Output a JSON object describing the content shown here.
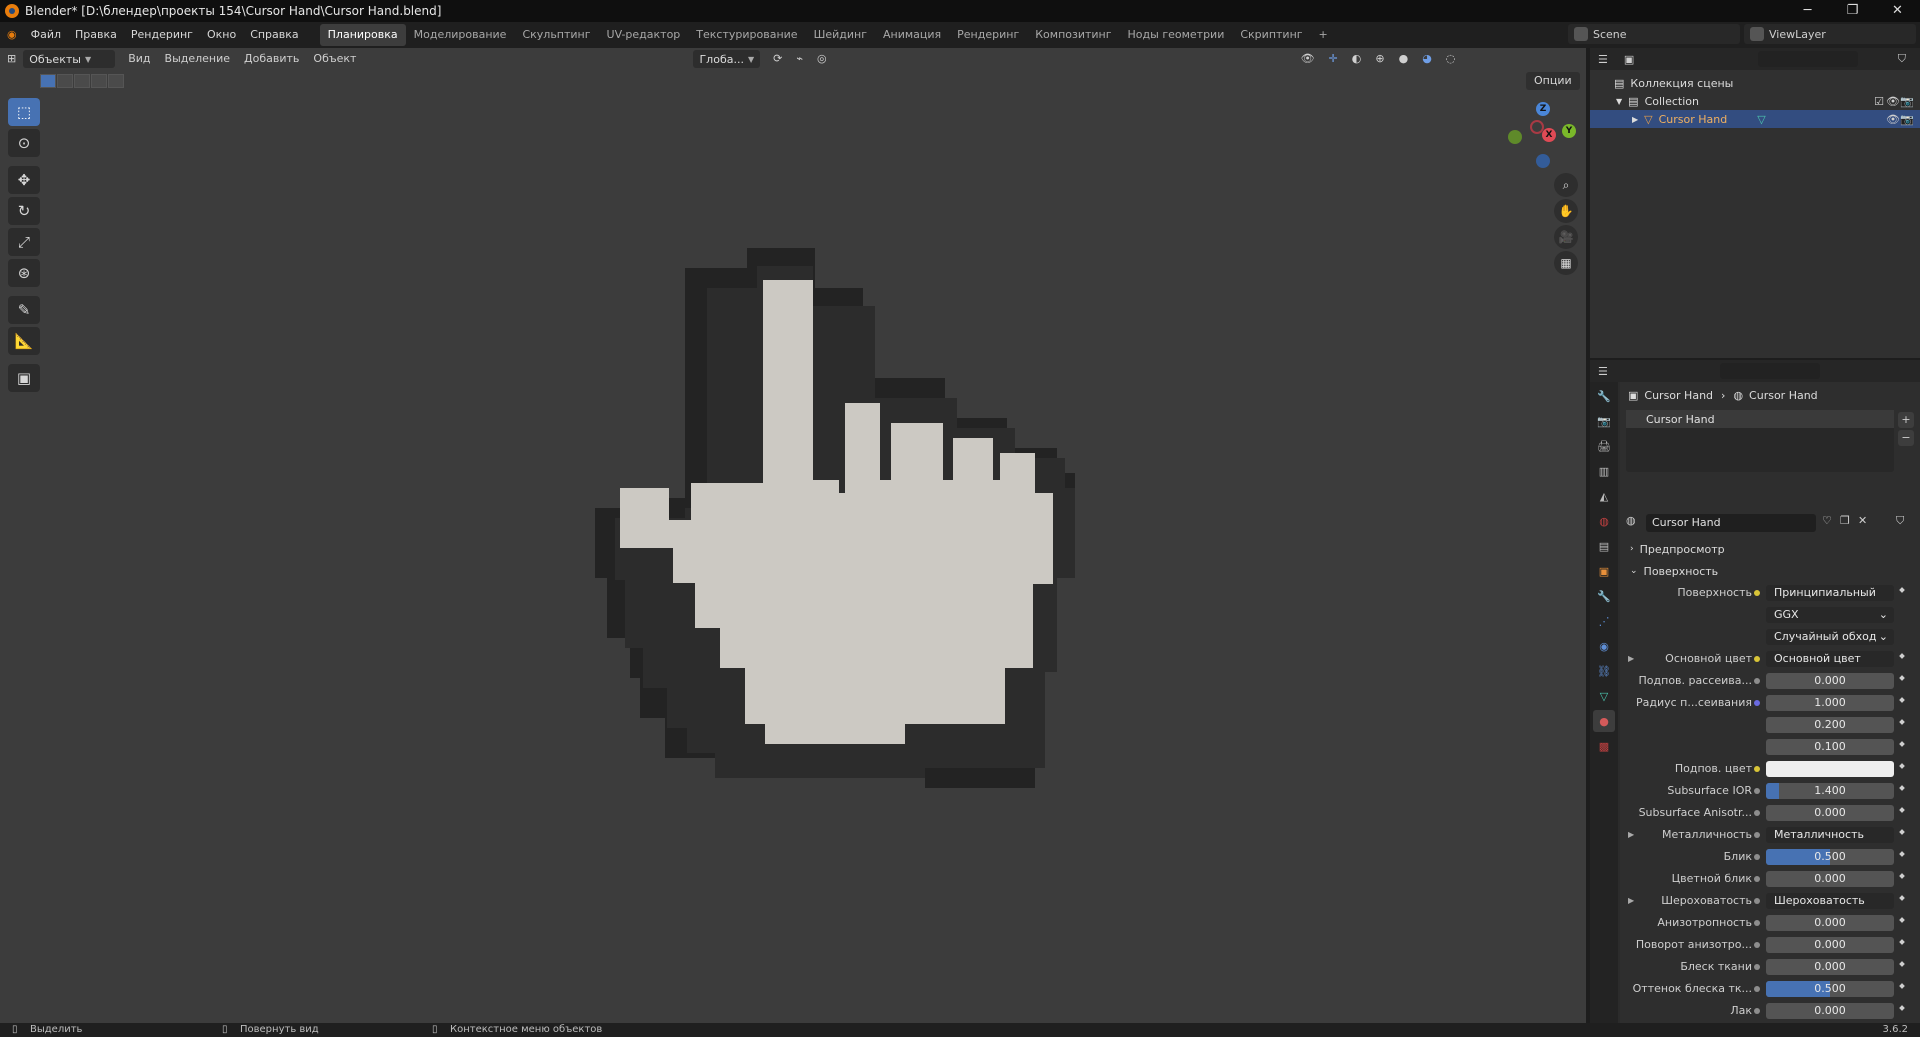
{
  "titlebar": {
    "title": "Blender* [D:\\блендер\\проекты 154\\Cursor Hand\\Cursor Hand.blend]",
    "minimize": "─",
    "restore": "❐",
    "close": "✕"
  },
  "menu": [
    "Файл",
    "Правка",
    "Рендеринг",
    "Окно",
    "Справка"
  ],
  "workspaces": [
    {
      "label": "Планировка",
      "active": true
    },
    {
      "label": "Моделирование"
    },
    {
      "label": "Скульптинг"
    },
    {
      "label": "UV-редактор"
    },
    {
      "label": "Текстурирование"
    },
    {
      "label": "Шейдинг"
    },
    {
      "label": "Анимация"
    },
    {
      "label": "Рендеринг"
    },
    {
      "label": "Композитинг"
    },
    {
      "label": "Ноды геометрии"
    },
    {
      "label": "Скриптинг"
    }
  ],
  "add_workspace": "+",
  "scene": {
    "name": "Scene"
  },
  "viewlayer": {
    "name": "ViewLayer"
  },
  "viewport": {
    "mode": "Объекты",
    "menu": [
      "Вид",
      "Выделение",
      "Добавить",
      "Объект"
    ],
    "transform_orientation": "Глоба...",
    "options": "Опции"
  },
  "gizmo": {
    "z": "Z",
    "y": "Y",
    "x": "X"
  },
  "outliner": {
    "scene_collection": "Коллекция сцены",
    "collection": "Collection",
    "object": "Cursor Hand"
  },
  "properties": {
    "breadcrumb_object": "Cursor Hand",
    "breadcrumb_material": "Cursor Hand",
    "slot_name": "Cursor Hand",
    "material_name": "Cursor Hand",
    "panels": {
      "preview": "Предпросмотр",
      "surface": "Поверхность"
    },
    "rows": [
      {
        "label": "Поверхность",
        "value": "Принципиальный BSDF",
        "kind": "node",
        "dot": "yellow"
      },
      {
        "label": "",
        "value": "GGX",
        "kind": "dropdown"
      },
      {
        "label": "",
        "value": "Случайный обход",
        "kind": "dropdown"
      },
      {
        "label": "Основной цвет",
        "value": "Основной цвет",
        "kind": "node",
        "dot": "yellow",
        "arrow": true
      },
      {
        "label": "Подпов. рассеива...",
        "value": "0.000",
        "kind": "number"
      },
      {
        "label": "Радиус п...сеивания",
        "value": "1.000",
        "kind": "number",
        "dot": "purple"
      },
      {
        "label": "",
        "value": "0.200",
        "kind": "number",
        "nodot": true
      },
      {
        "label": "",
        "value": "0.100",
        "kind": "number",
        "nodot": true
      },
      {
        "label": "Подпов. цвет",
        "value": "",
        "kind": "color",
        "dot": "yellow"
      },
      {
        "label": "Subsurface IOR",
        "value": "1.400",
        "kind": "number",
        "fill": 0.1
      },
      {
        "label": "Subsurface Anisotr...",
        "value": "0.000",
        "kind": "number"
      },
      {
        "label": "Металличность",
        "value": "Металличность",
        "kind": "node",
        "arrow": true
      },
      {
        "label": "Блик",
        "value": "0.500",
        "kind": "number",
        "fill": 0.5
      },
      {
        "label": "Цветной блик",
        "value": "0.000",
        "kind": "number"
      },
      {
        "label": "Шероховатость",
        "value": "Шероховатость",
        "kind": "node",
        "arrow": true
      },
      {
        "label": "Анизотропность",
        "value": "0.000",
        "kind": "number"
      },
      {
        "label": "Поворот анизотро...",
        "value": "0.000",
        "kind": "number"
      },
      {
        "label": "Блеск ткани",
        "value": "0.000",
        "kind": "number"
      },
      {
        "label": "Оттенок блеска тк...",
        "value": "0.500",
        "kind": "number",
        "fill": 0.5
      },
      {
        "label": "Лак",
        "value": "0.000",
        "kind": "number"
      }
    ]
  },
  "statusbar": {
    "select": "Выделить",
    "rotate": "Повернуть вид",
    "context": "Контекстное меню объектов",
    "version": "3.6.2"
  }
}
